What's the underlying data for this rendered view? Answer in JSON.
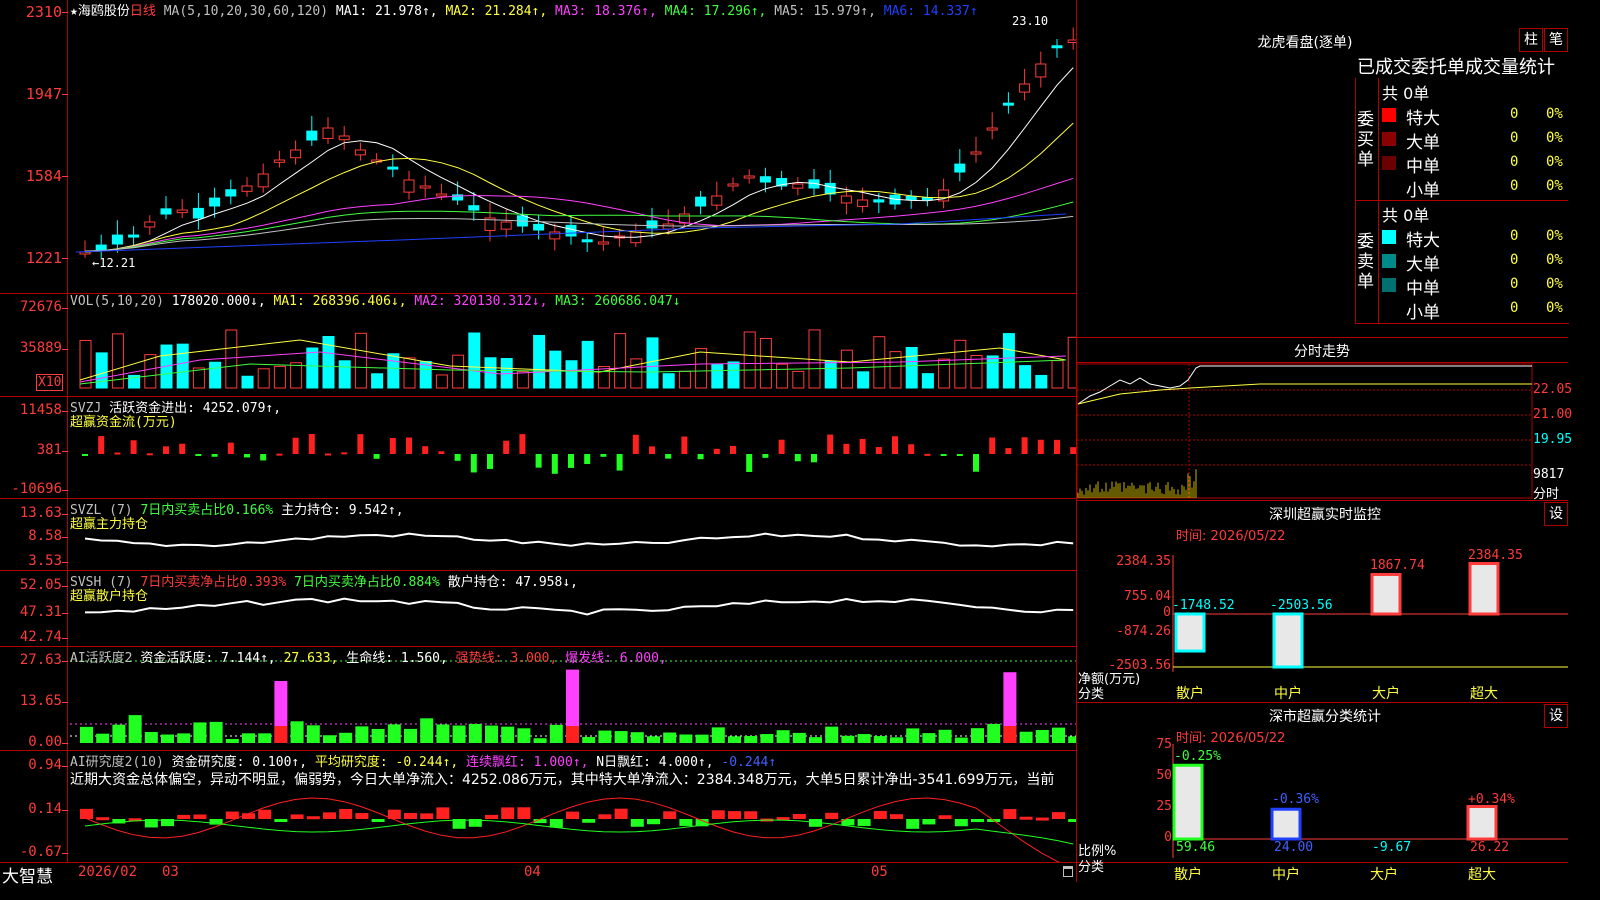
{
  "stock": {
    "star": "★",
    "name": "海鸥股份",
    "period": "日线",
    "ma_params": "MA(5,10,20,30,60,120)",
    "ma": [
      {
        "label": "MA1: 21.978↑,",
        "color": "#ffffff"
      },
      {
        "label": "MA2: 21.284↑,",
        "color": "#ffff40"
      },
      {
        "label": "MA3: 18.376↑,",
        "color": "#ff40ff"
      },
      {
        "label": "MA4: 17.296↑,",
        "color": "#40ff40"
      },
      {
        "label": "MA5: 15.979↑,",
        "color": "#c0c0c0"
      },
      {
        "label": "MA6: 14.337↑",
        "color": "#2040ff"
      }
    ],
    "high_label": "23.10",
    "low_label": "←12.21"
  },
  "price_axis": [
    "2310",
    "1947",
    "1584",
    "1221"
  ],
  "volume": {
    "axis": [
      "72676",
      "35889"
    ],
    "unit": "X10",
    "title": "VOL(5,10,20)",
    "value": "178020.000↓,",
    "ma1": "MA1: 268396.406↓,",
    "ma2": "MA2: 320130.312↓,",
    "ma3": "MA3: 260686.047↓"
  },
  "svzj": {
    "axis": [
      "11458",
      "381",
      "-10696"
    ],
    "title": "SVZJ",
    "text": "活跃资金进出: 4252.079↑,",
    "subtitle": "超赢资金流(万元)"
  },
  "svzl": {
    "axis": [
      "13.63",
      "8.58",
      "3.53"
    ],
    "title": "SVZL (7)",
    "text1": "7日内买卖占比0.166%",
    "text2": "主力持仓: 9.542↑,",
    "subtitle": "超赢主力持仓"
  },
  "svsh": {
    "axis": [
      "52.05",
      "47.31",
      "42.74"
    ],
    "title": "SVSH (7)",
    "text1": "7日内买卖净占比0.393%",
    "text2": "7日内买卖净占比0.884%",
    "text3": "散户持仓: 47.958↓,",
    "subtitle": "超赢散户持仓"
  },
  "ai_active": {
    "axis": [
      "27.63",
      "13.65",
      "0.00"
    ],
    "title": "AI活跃度2",
    "t1": "资金活跃度: 7.144↑,",
    "t2": "27.633,",
    "t3": "生命线: 1.560,",
    "t4": "强势线: 3.000,",
    "t5": "爆发线: 6.000,"
  },
  "ai_research": {
    "axis": [
      "0.94",
      "0.14",
      "-0.67"
    ],
    "title": "AI研究度2(10)",
    "t1": "资金研究度: 0.100↑,",
    "t2": "平均研究度: -0.244↑,",
    "t3": "连续飘红: 1.000↑,",
    "t4": "N日飘红: 4.000↑,",
    "t5": "-0.244↑",
    "comment": "近期大资金总体偏空，异动不明显，偏弱势，今日大单净流入：4252.086万元，其中特大单净流入：2384.348万元，大单5日累计净出-3541.699万元，当前"
  },
  "bottom": {
    "logo": "大智慧",
    "date": "2026/02",
    "months": [
      "03",
      "04",
      "05"
    ]
  },
  "lhb": {
    "title": "龙虎看盘(逐单)",
    "btn_bar": "柱",
    "btn_pen": "笔",
    "header": "已成交委托单成交量统计",
    "buy_label": "委买单",
    "sell_label": "委卖单",
    "buy_total": "共 0单",
    "sell_total": "共 0单",
    "buy_rows": [
      {
        "name": "特大",
        "count": "0",
        "pct": "0%",
        "color": "#ff0000"
      },
      {
        "name": "大单",
        "count": "0",
        "pct": "0%",
        "color": "#8b0000"
      },
      {
        "name": "中单",
        "count": "0",
        "pct": "0%",
        "color": "#6b0000"
      },
      {
        "name": "小单",
        "count": "0",
        "pct": "0%",
        "color": ""
      }
    ],
    "sell_rows": [
      {
        "name": "特大",
        "count": "0",
        "pct": "0%",
        "color": "#00ffff"
      },
      {
        "name": "大单",
        "count": "0",
        "pct": "0%",
        "color": "#008b8b"
      },
      {
        "name": "中单",
        "count": "0",
        "pct": "0%",
        "color": "#007070"
      },
      {
        "name": "小单",
        "count": "0",
        "pct": "0%",
        "color": ""
      }
    ]
  },
  "fenshi": {
    "title": "分时走势",
    "price_axis": [
      "22.05",
      "21.00",
      "19.95"
    ],
    "vol_label": "9817",
    "vol_unit": "分时"
  },
  "sz_monitor": {
    "title": "深圳超赢实时监控",
    "btn": "设",
    "time": "时间: 2026/05/22",
    "axis": [
      "2384.35",
      "755.04",
      "0",
      "-874.26",
      "-2503.56"
    ],
    "ylabel1": "净额(万元)",
    "ylabel2": "分类",
    "bars": [
      {
        "cat": "散户",
        "value": -1748.52,
        "label": "-1748.52"
      },
      {
        "cat": "中户",
        "value": -2503.56,
        "label": "-2503.56"
      },
      {
        "cat": "大户",
        "value": 1867.74,
        "label": "1867.74"
      },
      {
        "cat": "超大",
        "value": 2384.35,
        "label": "2384.35"
      }
    ]
  },
  "sz_class": {
    "title": "深市超赢分类统计",
    "btn": "设",
    "time": "时间: 2026/05/22",
    "axis": [
      "75",
      "50",
      "25",
      "0"
    ],
    "ylabel1": "比例%",
    "ylabel2": "分类",
    "bars": [
      {
        "cat": "散户",
        "value": 59.46,
        "label": "59.46",
        "change": "-0.25%"
      },
      {
        "cat": "中户",
        "value": 24.0,
        "label": "24.00",
        "change": "-0.36%"
      },
      {
        "cat": "大户",
        "value": -9.67,
        "label": "-9.67",
        "change": ""
      },
      {
        "cat": "超大",
        "value": 26.22,
        "label": "26.22",
        "change": "+0.34%"
      }
    ]
  }
}
